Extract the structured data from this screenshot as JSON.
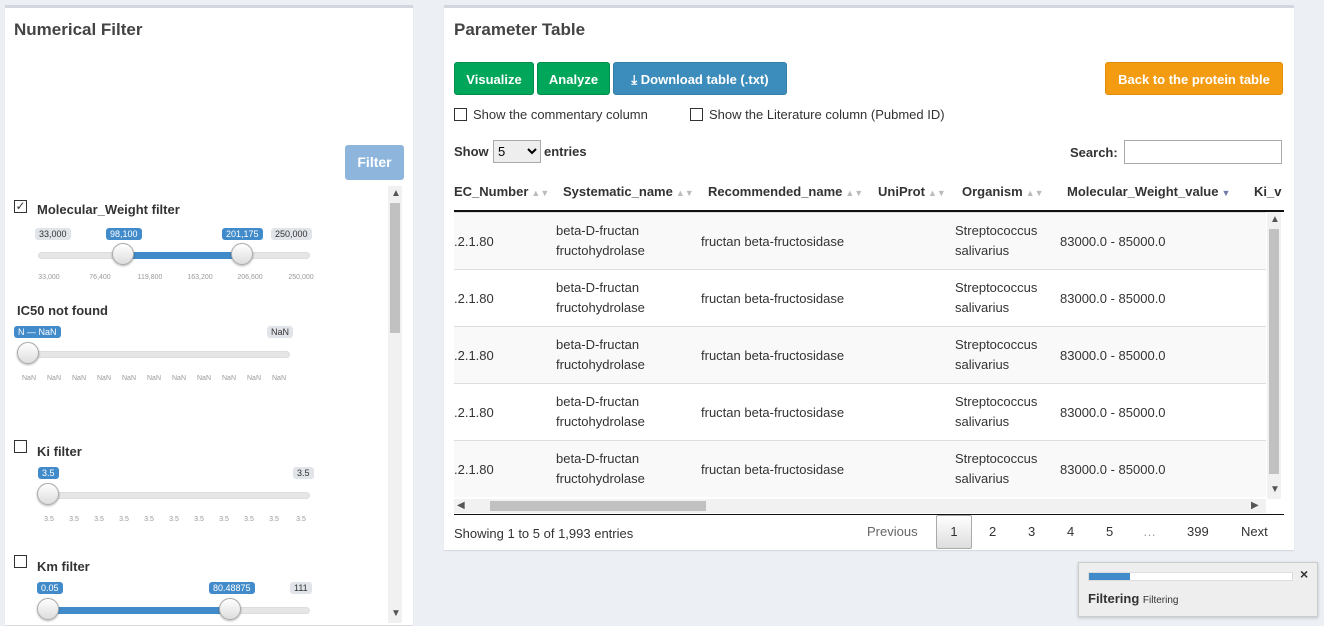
{
  "left": {
    "title": "Numerical Filter",
    "filter_button": "Filter",
    "filters": [
      {
        "label": "Molecular_Weight filter",
        "checked": "✓",
        "min_label": "33,000",
        "max_label": "250,000",
        "from_label": "98,100",
        "to_label": "201,175",
        "ticks": [
          "33,000",
          "76,400",
          "119,800",
          "163,200",
          "206,600",
          "250,000"
        ]
      },
      {
        "label": "IC50 not found",
        "from_label": "N — NaN",
        "max_label": "NaN",
        "ticks": [
          "NaN",
          "NaN",
          "NaN",
          "NaN",
          "NaN",
          "NaN",
          "NaN",
          "NaN",
          "NaN",
          "NaN",
          "NaN"
        ]
      },
      {
        "label": "Ki filter",
        "from_label": "3.5",
        "max_label": "3.5",
        "ticks": [
          "3.5",
          "3.5",
          "3.5",
          "3.5",
          "3.5",
          "3.5",
          "3.5",
          "3.5",
          "3.5",
          "3.5",
          "3.5"
        ]
      },
      {
        "label": "Km filter",
        "from_label": "0.05",
        "to_label": "80.48875",
        "max_label": "111"
      }
    ]
  },
  "right": {
    "title": "Parameter Table",
    "buttons": {
      "visualize": "Visualize",
      "analyze": "Analyze",
      "download": "Download table (.txt)",
      "back": "Back to the protein table"
    },
    "checkboxes": {
      "commentary": "Show the commentary column",
      "literature": "Show the Literature column (Pubmed ID)"
    },
    "length": {
      "show": "Show",
      "value": "5",
      "entries": "entries"
    },
    "search": {
      "label": "Search:",
      "value": ""
    },
    "columns": [
      "EC_Number",
      "Systematic_name",
      "Recommended_name",
      "UniProt",
      "Organism",
      "Molecular_Weight_value",
      "Ki_v"
    ],
    "rows": [
      {
        "ec": ".2.1.80",
        "sys1": "beta-D-fructan",
        "sys2": "fructohydrolase",
        "rec": "fructan beta-fructosidase",
        "uni": "",
        "org1": "Streptococcus",
        "org2": "salivarius",
        "mw": "83000.0 - 85000.0"
      },
      {
        "ec": ".2.1.80",
        "sys1": "beta-D-fructan",
        "sys2": "fructohydrolase",
        "rec": "fructan beta-fructosidase",
        "uni": "",
        "org1": "Streptococcus",
        "org2": "salivarius",
        "mw": "83000.0 - 85000.0"
      },
      {
        "ec": ".2.1.80",
        "sys1": "beta-D-fructan",
        "sys2": "fructohydrolase",
        "rec": "fructan beta-fructosidase",
        "uni": "",
        "org1": "Streptococcus",
        "org2": "salivarius",
        "mw": "83000.0 - 85000.0"
      },
      {
        "ec": ".2.1.80",
        "sys1": "beta-D-fructan",
        "sys2": "fructohydrolase",
        "rec": "fructan beta-fructosidase",
        "uni": "",
        "org1": "Streptococcus",
        "org2": "salivarius",
        "mw": "83000.0 - 85000.0"
      },
      {
        "ec": ".2.1.80",
        "sys1": "beta-D-fructan",
        "sys2": "fructohydrolase",
        "rec": "fructan beta-fructosidase",
        "uni": "",
        "org1": "Streptococcus",
        "org2": "salivarius",
        "mw": "83000.0 - 85000.0"
      }
    ],
    "info": "Showing 1 to 5 of 1,993 entries",
    "pagination": {
      "previous": "Previous",
      "pages": [
        "1",
        "2",
        "3",
        "4",
        "5",
        "…",
        "399"
      ],
      "next": "Next"
    }
  },
  "progress": {
    "title": "Filtering",
    "detail": "Filtering",
    "close": "×",
    "value": 0.2
  },
  "colors": {
    "primary": "#3c8dbc",
    "success": "#00a65a",
    "warning": "#f39c12",
    "slider": "#428bca"
  }
}
